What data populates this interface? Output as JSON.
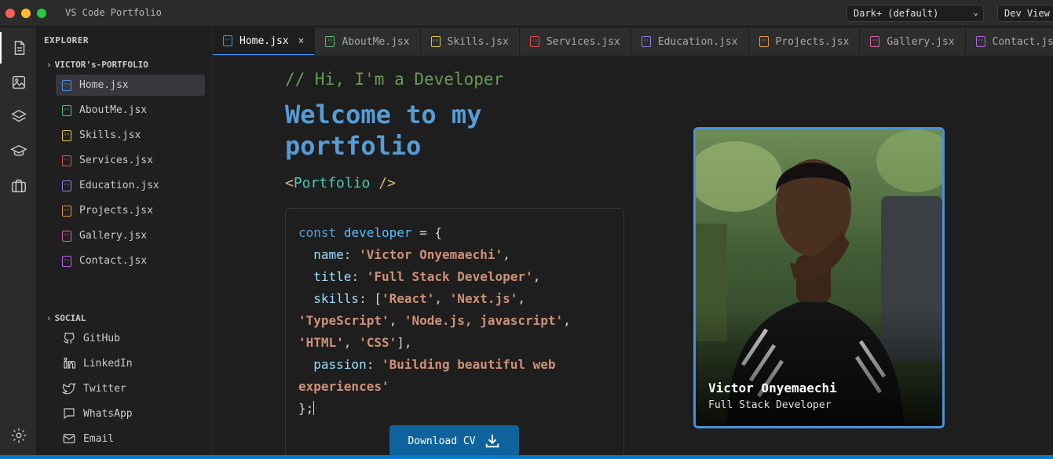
{
  "window": {
    "title": "VS Code Portfolio",
    "theme_select": "Dark+ (default)",
    "view_select": "Dev View"
  },
  "sidebar": {
    "title": "EXPLORER",
    "folder": "VICTOR's-PORTFOLIO",
    "files": [
      {
        "label": "Home.jsx",
        "color": "#4f8fd8"
      },
      {
        "label": "AboutMe.jsx",
        "color": "#4ec275"
      },
      {
        "label": "Skills.jsx",
        "color": "#e2c541"
      },
      {
        "label": "Services.jsx",
        "color": "#e05252"
      },
      {
        "label": "Education.jsx",
        "color": "#8f7fe0"
      },
      {
        "label": "Projects.jsx",
        "color": "#e8963a"
      },
      {
        "label": "Gallery.jsx",
        "color": "#d965a8"
      },
      {
        "label": "Contact.jsx",
        "color": "#b467e0"
      }
    ],
    "social_title": "SOCIAL",
    "social": [
      {
        "label": "GitHub",
        "icon": "github-icon"
      },
      {
        "label": "LinkedIn",
        "icon": "linkedin-icon"
      },
      {
        "label": "Twitter",
        "icon": "twitter-icon"
      },
      {
        "label": "WhatsApp",
        "icon": "whatsapp-icon"
      },
      {
        "label": "Email",
        "icon": "email-icon"
      }
    ]
  },
  "tabs": [
    {
      "label": "Home.jsx",
      "close": "×"
    },
    {
      "label": "AboutMe.jsx"
    },
    {
      "label": "Skills.jsx"
    },
    {
      "label": "Services.jsx"
    },
    {
      "label": "Education.jsx"
    },
    {
      "label": "Projects.jsx"
    },
    {
      "label": "Gallery.jsx"
    },
    {
      "label": "Contact.jsx"
    }
  ],
  "hero": {
    "comment": "// Hi, I'm a Developer",
    "headline": "Welcome to my portfolio",
    "tag_open": "<",
    "tag_name": "Portfolio",
    "tag_close": " />"
  },
  "code": {
    "l1_kw": "const",
    "l1_var": "developer",
    "l1_rest": " = {",
    "name_key": "name",
    "name_val": "'Victor Onyemaechi'",
    "title_key": "title",
    "title_val": "'Full Stack Developer'",
    "skills_key": "skills",
    "skill1": "'React'",
    "skill2": "'Next.js'",
    "skill3": "'TypeScript'",
    "skill4": "'Node.js, javascript'",
    "skill5": "'HTML'",
    "skill6": "'CSS'",
    "passion_key": "passion",
    "passion_val1": "'Building beautiful web",
    "passion_val2": "experiences'",
    "end": "};"
  },
  "download_button": "Download CV",
  "profile": {
    "name": "Victor Onyemaechi",
    "role": "Full Stack Developer"
  },
  "colors": {
    "accent": "#007acc",
    "comment": "#6a9955",
    "keyword": "#569cd6",
    "string": "#ce9178"
  }
}
